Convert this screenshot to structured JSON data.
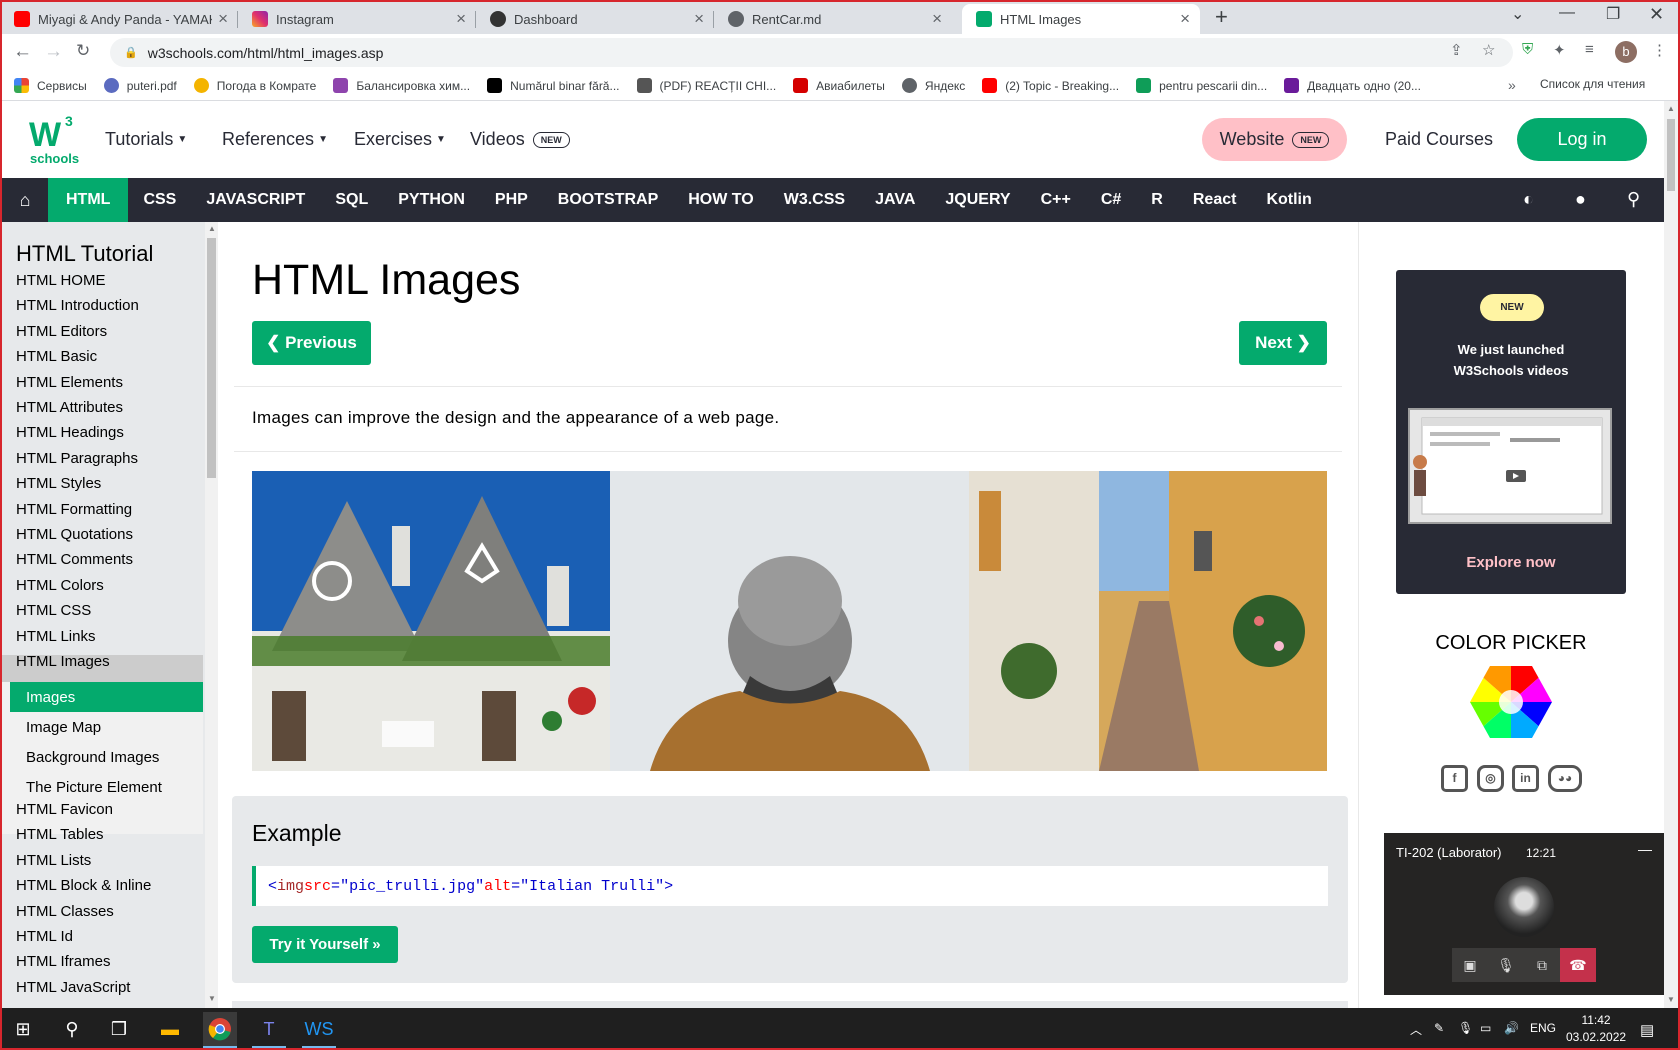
{
  "browser": {
    "tabs": [
      {
        "title": "Miyagi & Andy Panda - YAMAKASI",
        "icon": "youtube-icon",
        "color": "#ff0000"
      },
      {
        "title": "Instagram",
        "icon": "instagram-icon",
        "color": "#e1306c"
      },
      {
        "title": "Dashboard",
        "icon": "moodle-icon",
        "color": "#333333"
      },
      {
        "title": "RentCar.md",
        "icon": "globe-icon",
        "color": "#5f6368"
      },
      {
        "title": "HTML Images",
        "icon": "w3schools-icon",
        "color": "#04aa6d"
      }
    ],
    "url": "w3schools.com/html/html_images.asp",
    "profile_initial": "b",
    "bookmarks": [
      {
        "label": "Сервисы",
        "icon": "apps-grid-icon",
        "color": "#ea4335"
      },
      {
        "label": "puteri.pdf",
        "icon": "globe-icon",
        "color": "#5b6bc0"
      },
      {
        "label": "Погода в Комрате",
        "icon": "weather-icon",
        "color": "#f4b400"
      },
      {
        "label": "Балансировка хим...",
        "icon": "flask-icon",
        "color": "#8e44ad"
      },
      {
        "label": "Numărul binar fără...",
        "icon": "binary-icon",
        "color": "#000000"
      },
      {
        "label": "(PDF) REACȚII CHI...",
        "icon": "academia-icon",
        "color": "#000000"
      },
      {
        "label": "Авиабилеты",
        "icon": "plane-icon",
        "color": "#d50000"
      },
      {
        "label": "Яндекс",
        "icon": "globe-icon",
        "color": "#5f6368"
      },
      {
        "label": "(2) Topic - Breaking...",
        "icon": "youtube-icon",
        "color": "#ff0000"
      },
      {
        "label": "pentru pescarii din...",
        "icon": "sheets-icon",
        "color": "#0f9d58"
      },
      {
        "label": "Двадцать одно (20...",
        "icon": "bookmark-icon",
        "color": "#6a1b9a"
      }
    ],
    "reading_list": "Список для чтения"
  },
  "w3": {
    "logo_text": "schools",
    "logo_super": "3",
    "nav": [
      "Tutorials",
      "References",
      "Exercises",
      "Videos"
    ],
    "new_badge": "NEW",
    "website": "Website",
    "paid_courses": "Paid Courses",
    "login": "Log in",
    "subjects": [
      "HTML",
      "CSS",
      "JAVASCRIPT",
      "SQL",
      "PYTHON",
      "PHP",
      "BOOTSTRAP",
      "HOW TO",
      "W3.CSS",
      "JAVA",
      "JQUERY",
      "C++",
      "C#",
      "R",
      "React",
      "Kotlin"
    ]
  },
  "sidebar": {
    "title": "HTML Tutorial",
    "items_before": [
      "HTML HOME",
      "HTML Introduction",
      "HTML Editors",
      "HTML Basic",
      "HTML Elements",
      "HTML Attributes",
      "HTML Headings",
      "HTML Paragraphs",
      "HTML Styles",
      "HTML Formatting",
      "HTML Quotations",
      "HTML Comments",
      "HTML Colors",
      "HTML CSS",
      "HTML Links",
      "HTML Images"
    ],
    "sub_items": [
      "Images",
      "Image Map",
      "Background Images",
      "The Picture Element"
    ],
    "items_after": [
      "HTML Favicon",
      "HTML Tables",
      "HTML Lists",
      "HTML Block & Inline",
      "HTML Classes",
      "HTML Id",
      "HTML Iframes",
      "HTML JavaScript"
    ]
  },
  "main": {
    "title": "HTML Images",
    "prev": "❮ Previous",
    "next": "Next ❯",
    "intro": "Images can improve the design and the appearance of a web page.",
    "example_title": "Example",
    "code": {
      "tag_open": "<",
      "tag_name": "img",
      "attr1": " src",
      "val1": "\"pic_trulli.jpg\"",
      "attr2": " alt",
      "val2": "\"Italian Trulli\"",
      "tag_close": ">"
    },
    "try_button": "Try it Yourself »"
  },
  "promo": {
    "badge": "NEW",
    "line1": "We just launched",
    "line2": "W3Schools videos",
    "explore": "Explore now"
  },
  "color_picker": {
    "title": "COLOR PICKER"
  },
  "teams_call": {
    "title": "TI-202 (Laborator)",
    "time": "12:21"
  },
  "taskbar": {
    "lang": "ENG",
    "time": "11:42",
    "date": "03.02.2022"
  }
}
